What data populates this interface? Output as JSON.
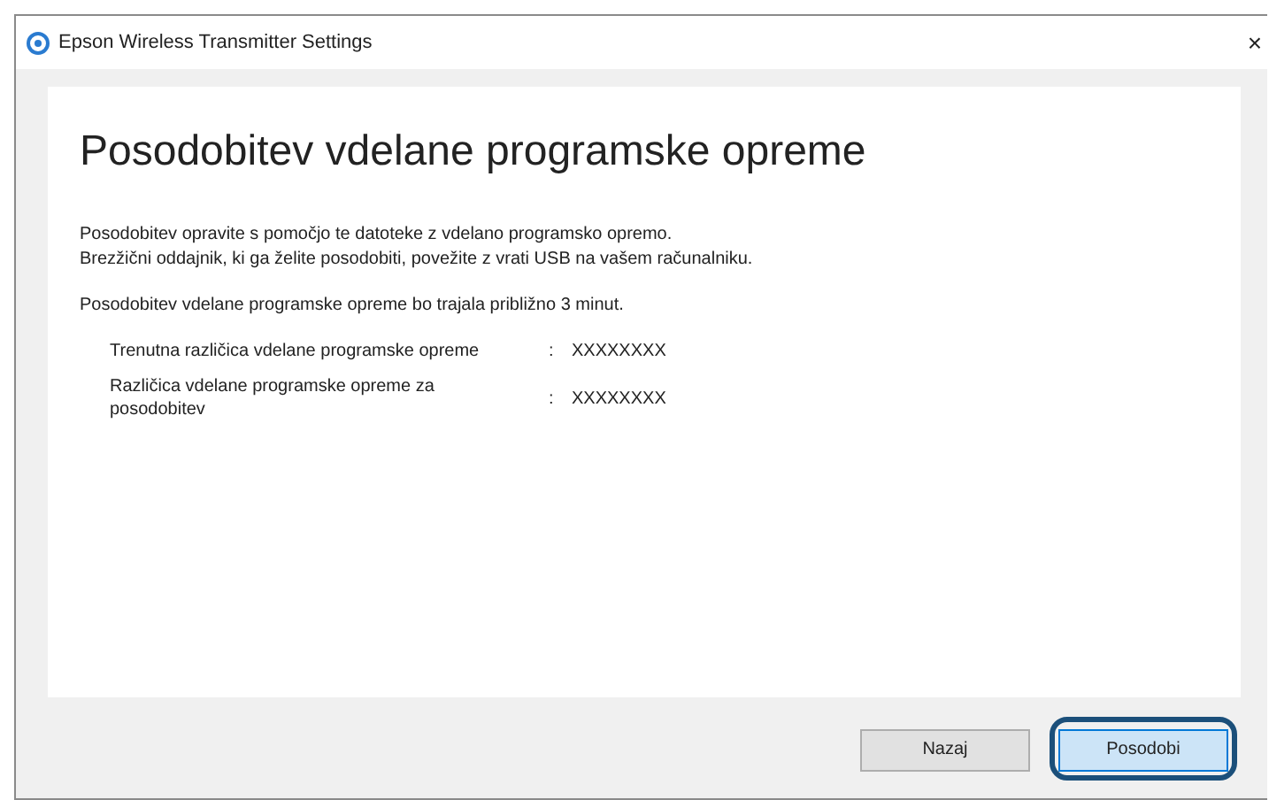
{
  "window": {
    "title": "Epson Wireless Transmitter Settings",
    "close": "×"
  },
  "heading": "Posodobitev vdelane programske opreme",
  "intro": [
    "Posodobitev opravite s pomočjo te datoteke z vdelano programsko opremo.",
    "Brezžični oddajnik, ki ga želite posodobiti, povežite z vrati USB na vašem računalniku."
  ],
  "duration": "Posodobitev vdelane programske opreme bo trajala približno 3 minut.",
  "versions": [
    {
      "label": "Trenutna različica vdelane programske opreme",
      "separator": ":",
      "value": "XXXXXXXX"
    },
    {
      "label": "Različica vdelane programske opreme za posodobitev",
      "separator": ":",
      "value": "XXXXXXXX"
    }
  ],
  "buttons": [
    {
      "label": "Nazaj",
      "default": false,
      "highlighted": false
    },
    {
      "label": "Posodobi",
      "default": true,
      "highlighted": true
    }
  ]
}
